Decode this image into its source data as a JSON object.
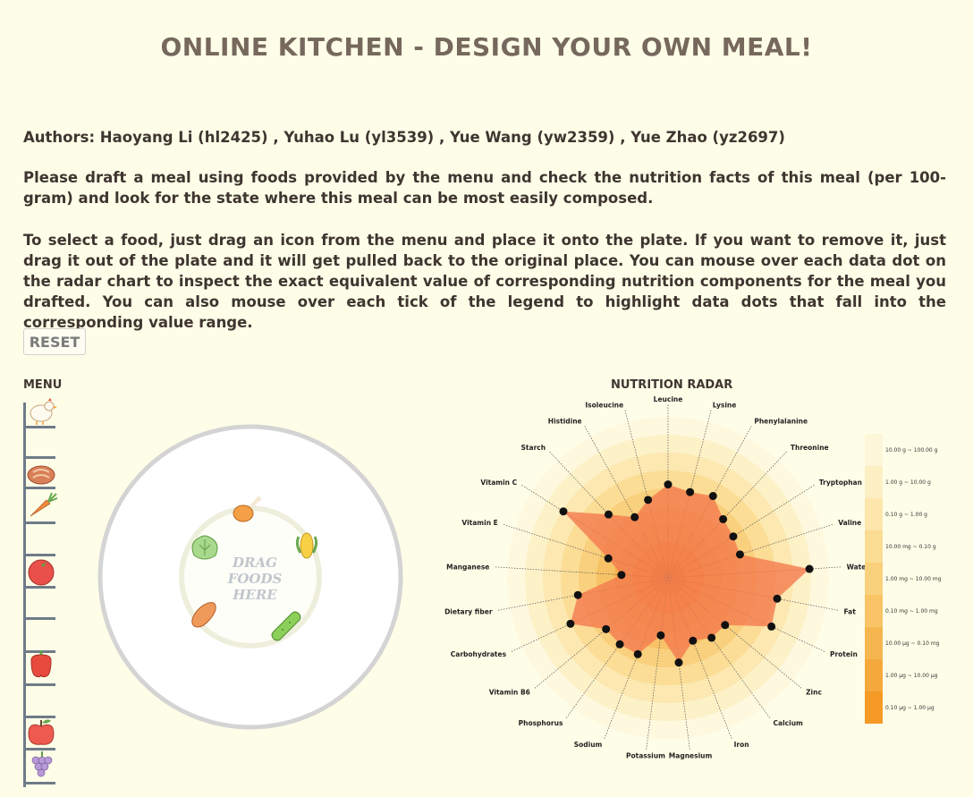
{
  "page": {
    "title": "ONLINE KITCHEN - DESIGN YOUR OWN MEAL!",
    "authors": "Authors: Haoyang Li (hl2425) , Yuhao Lu (yl3539) , Yue Wang (yw2359) , Yue Zhao (yz2697)",
    "instructions_1": "Please draft a meal using foods provided by the menu and check the nutrition facts of this meal (per 100-gram) and look for the state where this meal can be most easily composed.",
    "instructions_2": "To select a food, just drag an icon from the menu and place it onto the plate. If you want to remove it, just drag it out of the plate and it will get pulled back to the original place. You can mouse over each data dot on the radar chart to inspect the exact equivalent value of corresponding nutrition components for the meal you drafted. You can also mouse over each tick of the legend to highlight data dots that fall into the corresponding value range.",
    "reset_label": "RESET"
  },
  "menu": {
    "label": "MENU",
    "items": [
      {
        "name": "chicken",
        "icon": "chicken-icon"
      },
      {
        "name": "steak",
        "icon": "steak-icon"
      },
      {
        "name": "carrot",
        "icon": "carrot-icon"
      },
      {
        "name": "tomato",
        "icon": "tomato-icon"
      },
      {
        "name": "bell pepper",
        "icon": "bell-pepper-icon"
      },
      {
        "name": "apple",
        "icon": "apple-icon"
      },
      {
        "name": "grapes",
        "icon": "grapes-icon"
      }
    ]
  },
  "plate": {
    "hint_lines": [
      "DRAG",
      "FOODS",
      "HERE"
    ],
    "decor_icons": [
      "chicken-drumstick-icon",
      "corn-icon",
      "cucumber-icon",
      "sweet-potato-icon",
      "lettuce-icon"
    ]
  },
  "radar": {
    "label": "NUTRITION RADAR",
    "colors": {
      "fill": "#f47b4f",
      "dot": "#111111",
      "ring_light": "#fdf3cc",
      "ring_dark": "#f6b75a"
    }
  },
  "chart_data": {
    "type": "radar",
    "title": "NUTRITION RADAR",
    "axes": [
      "Leucine",
      "Lysine",
      "Phenylalanine",
      "Threonine",
      "Tryptophan",
      "Valine",
      "Water",
      "Fat",
      "Protein",
      "Zinc",
      "Calcium",
      "Iron",
      "Magnesium",
      "Potassium",
      "Sodium",
      "Phosphorus",
      "Vitamin B6",
      "Carbohydrates",
      "Dietary fiber",
      "Manganese",
      "Vitamin E",
      "Vitamin C",
      "Starch",
      "Histidine",
      "Isoleucine"
    ],
    "values": [
      0.58,
      0.55,
      0.58,
      0.5,
      0.48,
      0.47,
      0.88,
      0.69,
      0.71,
      0.46,
      0.46,
      0.42,
      0.53,
      0.36,
      0.51,
      0.51,
      0.5,
      0.67,
      0.57,
      0.29,
      0.39,
      0.77,
      0.54,
      0.43,
      0.5
    ],
    "legend_ticks": [
      "10.00 g ~ 100.00 g",
      "1.00 g ~ 10.00 g",
      "0.10 g ~ 1.00 g",
      "10.00 mg ~ 0.10 g",
      "1.00 mg ~ 10.00 mg",
      "0.10 mg ~ 1.00 mg",
      "10.00 µg ~ 0.10 mg",
      "1.00 µg ~ 10.00 µg",
      "0.10 µg ~ 1.00 µg"
    ],
    "legend_colors": [
      "#fdf6d8",
      "#fdefc4",
      "#fce6ab",
      "#fbdc93",
      "#f9d07b",
      "#f8c465",
      "#f6b64f",
      "#f5a83b",
      "#f49a25"
    ]
  }
}
